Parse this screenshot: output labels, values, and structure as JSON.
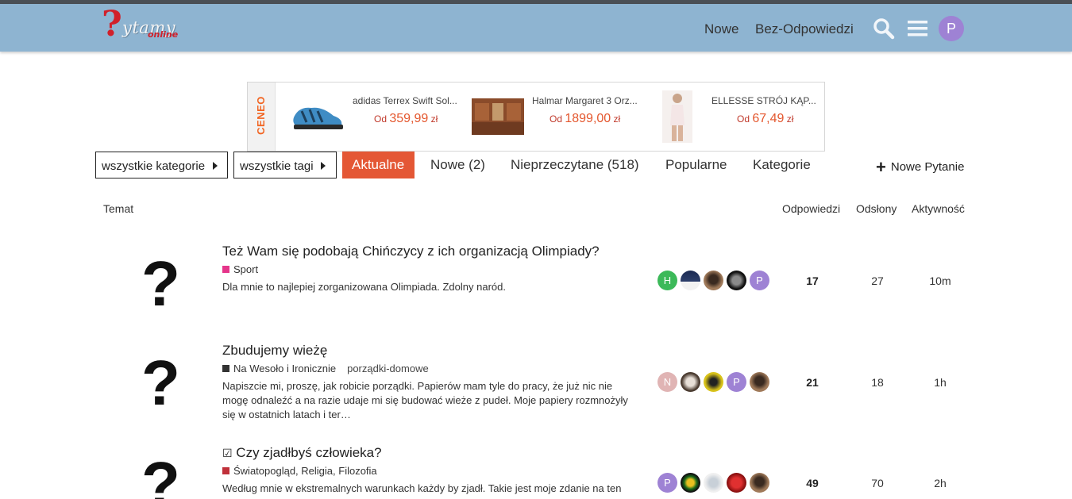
{
  "header": {
    "logo_word": "ytamy",
    "logo_online": "online",
    "logo_q": "?",
    "nav": [
      {
        "label": "Nowe"
      },
      {
        "label": "Bez-Odpowiedzi"
      }
    ],
    "avatar_letter": "P",
    "colors": {
      "bar": "#8eb4d1",
      "avatar": "#9e82d4"
    }
  },
  "ad": {
    "brand": "CENEO",
    "items": [
      {
        "name": "adidas Terrex Swift Sol...",
        "prefix": "Od",
        "amount": "359,99",
        "currency": "zł"
      },
      {
        "name": "Halmar Margaret 3 Orz...",
        "prefix": "Od",
        "amount": "1899,00",
        "currency": "zł"
      },
      {
        "name": "ELLESSE STRÓJ KĄP...",
        "prefix": "Od",
        "amount": "67,49",
        "currency": "zł"
      }
    ]
  },
  "filters": {
    "categories": "wszystkie kategorie",
    "tags": "wszystkie tagi"
  },
  "tabs": [
    {
      "label": "Aktualne",
      "active": true
    },
    {
      "label": "Nowe (2)"
    },
    {
      "label": "Nieprzeczytane (518)"
    },
    {
      "label": "Popularne"
    },
    {
      "label": "Kategorie"
    }
  ],
  "new_question_label": "Nowe Pytanie",
  "columns": {
    "topic": "Temat",
    "replies": "Odpowiedzi",
    "views": "Odsłony",
    "activity": "Aktywność"
  },
  "topics": [
    {
      "icon": "?",
      "title": "Też Wam się podobają Chińczycy z ich organizacją Olimpiady?",
      "category": "Sport",
      "category_color": "#e5358a",
      "tag": "",
      "excerpt": "Dla mnie to najlepiej zorganizowana Olimpiada. Zdolny naród.",
      "posters": [
        {
          "letter": "H",
          "color": "#3cb959"
        },
        {
          "letter": "",
          "color": "#2c3e6a"
        },
        {
          "letter": "",
          "color": "#6b4a3a"
        },
        {
          "letter": "",
          "color": "#1a1a1a"
        },
        {
          "letter": "P",
          "color": "#9e82d4"
        }
      ],
      "replies": "17",
      "views": "27",
      "activity": "10m"
    },
    {
      "icon": "?",
      "title": "Zbudujemy wieżę",
      "category": "Na Wesoło i Ironicznie",
      "category_color": "#333333",
      "tag": "porządki-domowe",
      "excerpt": "Napiszcie mi, proszę, jak robicie porządki. Papierów mam tyle do pracy, że już nic nie mogę odnaleźć a na razie udaje mi się budować wieże z pudeł. Moje papiery rozmnożyły się w ostatnich latach i ter…",
      "posters": [
        {
          "letter": "N",
          "color": "#e0b4b4"
        },
        {
          "letter": "",
          "color": "#4a3b30"
        },
        {
          "letter": "",
          "color": "#d8c21a"
        },
        {
          "letter": "P",
          "color": "#9e82d4"
        },
        {
          "letter": "",
          "color": "#6b4a3a"
        }
      ],
      "replies": "21",
      "views": "18",
      "activity": "1h"
    },
    {
      "icon": "?",
      "title": "Czy zjadłbyś człowieka?",
      "title_prefix": "☑",
      "category": "Światopogląd, Religia, Filozofia",
      "category_color": "#c0303a",
      "tag": "",
      "excerpt": "Według mnie w ekstremalnych warunkach każdy by zjadł. Takie jest moje zdanie na ten",
      "posters": [
        {
          "letter": "P",
          "color": "#9e82d4"
        },
        {
          "letter": "",
          "color": "#2a7a2a"
        },
        {
          "letter": "",
          "color": "#9aa0a6"
        },
        {
          "letter": "",
          "color": "#c0202a"
        },
        {
          "letter": "",
          "color": "#6b4a3a"
        }
      ],
      "replies": "49",
      "views": "70",
      "activity": "2h"
    }
  ]
}
